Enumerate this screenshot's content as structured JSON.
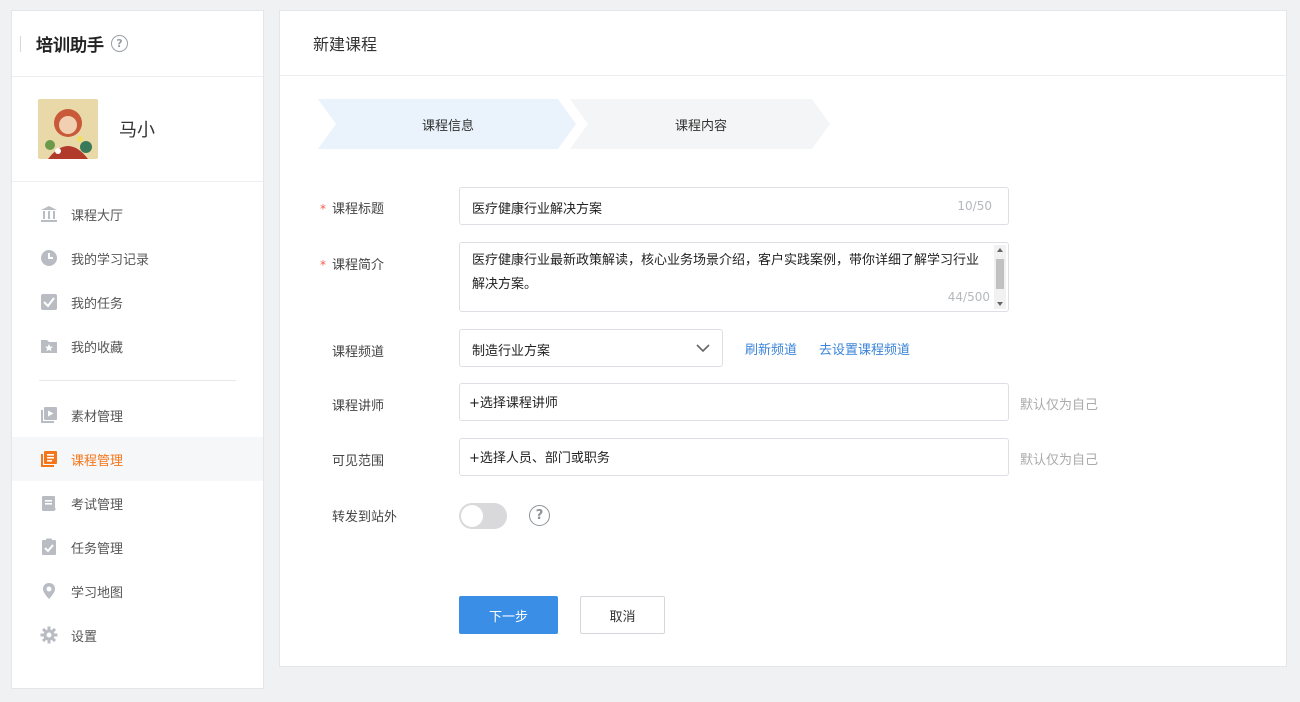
{
  "sidebar": {
    "title": "培训助手",
    "help_icon": "question-circle-icon",
    "user": {
      "name": "马小"
    },
    "items": [
      {
        "label": "课程大厅",
        "icon": "bank-icon"
      },
      {
        "label": "我的学习记录",
        "icon": "clock-icon"
      },
      {
        "label": "我的任务",
        "icon": "checkbox-icon"
      },
      {
        "label": "我的收藏",
        "icon": "star-folder-icon"
      },
      {
        "label": "素材管理",
        "icon": "media-library-icon"
      },
      {
        "label": "课程管理",
        "icon": "course-list-icon"
      },
      {
        "label": "考试管理",
        "icon": "exam-clipboard-icon"
      },
      {
        "label": "任务管理",
        "icon": "task-clipboard-icon"
      },
      {
        "label": "学习地图",
        "icon": "map-pin-icon"
      },
      {
        "label": "设置",
        "icon": "gear-icon"
      }
    ],
    "active_color": "#f5761a"
  },
  "main": {
    "title": "新建课程",
    "steps": [
      {
        "label": "课程信息",
        "active": true
      },
      {
        "label": "课程内容",
        "active": false
      }
    ],
    "form": {
      "title": {
        "label": "课程标题",
        "value": "医疗健康行业解决方案",
        "counter": "10/50"
      },
      "intro": {
        "label": "课程简介",
        "value": "医疗健康行业最新政策解读，核心业务场景介绍，客户实践案例，带你详细了解学习行业解决方案。",
        "counter": "44/500"
      },
      "channel": {
        "label": "课程频道",
        "value": "制造行业方案",
        "refresh": "刷新频道",
        "settings": "去设置课程频道"
      },
      "lecturer": {
        "label": "课程讲师",
        "placeholder": "+选择课程讲师",
        "hint": "默认仅为自己"
      },
      "visibility": {
        "label": "可见范围",
        "placeholder": "+选择人员、部门或职务",
        "hint": "默认仅为自己"
      },
      "share": {
        "label": "转发到站外",
        "enabled": false
      }
    },
    "buttons": {
      "next": "下一步",
      "cancel": "取消"
    }
  },
  "colors": {
    "primary": "#3a8ee6",
    "link": "#3b84d9",
    "required": "#f25c54",
    "active_step_bg": "#eaf3fc"
  }
}
